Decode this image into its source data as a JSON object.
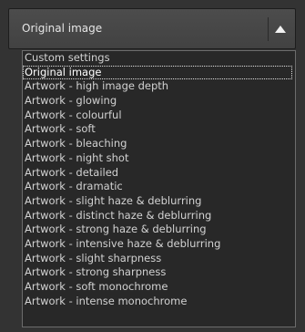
{
  "select": {
    "value": "Original image",
    "arrow_icon": "chevron-up-icon"
  },
  "options": [
    "Custom settings",
    "Original image",
    "Artwork - high image depth",
    "Artwork - glowing",
    "Artwork - colourful",
    "Artwork - soft",
    "Artwork - bleaching",
    "Artwork - night shot",
    "Artwork - detailed",
    "Artwork - dramatic",
    "Artwork - slight haze & deblurring",
    "Artwork - distinct haze & deblurring",
    "Artwork - strong haze & deblurring",
    "Artwork - intensive haze & deblurring",
    "Artwork - slight sharpness",
    "Artwork - strong sharpness",
    "Artwork - soft monochrome",
    "Artwork - intense monochrome"
  ],
  "highlighted_index": 1,
  "colors": {
    "background": "#333333",
    "list_background": "#282828",
    "text": "#d2d2d2"
  }
}
